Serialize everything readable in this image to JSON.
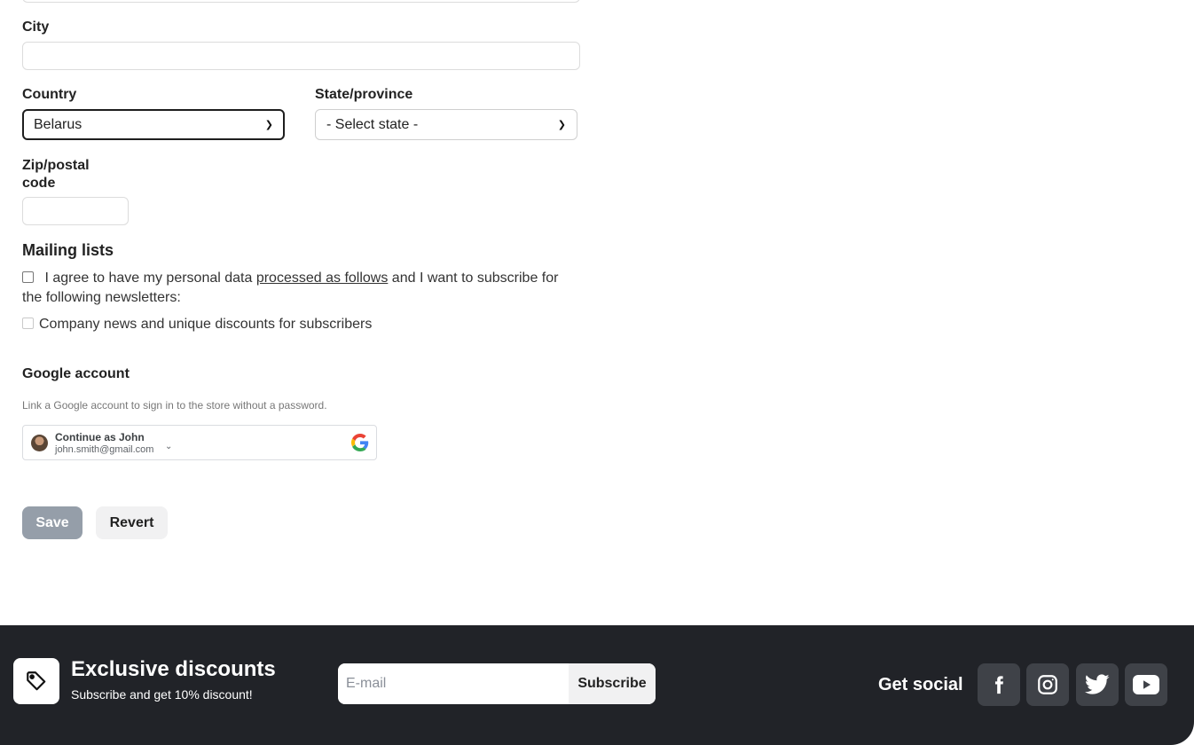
{
  "form": {
    "city": {
      "label": "City",
      "value": ""
    },
    "country": {
      "label": "Country",
      "selected": "Belarus"
    },
    "state": {
      "label": "State/province",
      "selected": "- Select state -"
    },
    "zip": {
      "label": "Zip/postal code",
      "value": ""
    }
  },
  "mailing": {
    "title": "Mailing lists",
    "agree_prefix": "I agree to have my personal data",
    "agree_link": "processed as follows",
    "agree_suffix": "and I want to subscribe for the following newsletters:",
    "newsletter_label": "Company news and unique discounts for subscribers"
  },
  "google": {
    "title": "Google account",
    "hint": "Link a Google account to sign in to the store without a password.",
    "continue_label": "Continue as John",
    "email": "john.smith@gmail.com"
  },
  "actions": {
    "save_label": "Save",
    "revert_label": "Revert"
  },
  "footer": {
    "promo_title": "Exclusive discounts",
    "promo_subtitle": "Subscribe and get 10% discount!",
    "email_placeholder": "E-mail",
    "subscribe_label": "Subscribe",
    "social_title": "Get social",
    "social_icons": [
      "facebook-icon",
      "instagram-icon",
      "twitter-icon",
      "youtube-icon"
    ]
  },
  "colors": {
    "footer_bg": "#212328",
    "save_bg": "#959ea9",
    "social_tile": "#3f4248"
  }
}
